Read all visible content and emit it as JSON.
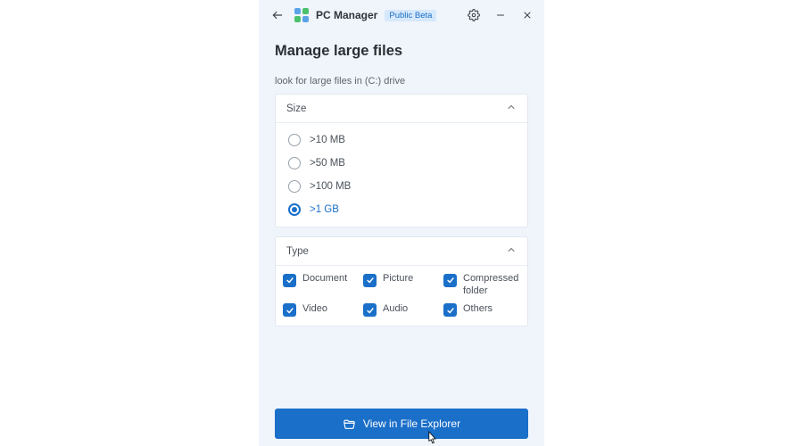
{
  "titlebar": {
    "app_name": "PC Manager",
    "badge": "Public Beta"
  },
  "header": {
    "title": "Manage large files",
    "subtitle": "look for large files in (C:) drive"
  },
  "size_panel": {
    "title": "Size",
    "options": [
      {
        "label": ">10 MB",
        "selected": false
      },
      {
        "label": ">50 MB",
        "selected": false
      },
      {
        "label": ">100 MB",
        "selected": false
      },
      {
        "label": ">1 GB",
        "selected": true
      }
    ]
  },
  "type_panel": {
    "title": "Type",
    "options": [
      {
        "label": "Document",
        "checked": true
      },
      {
        "label": "Picture",
        "checked": true
      },
      {
        "label": "Compressed folder",
        "checked": true
      },
      {
        "label": "Video",
        "checked": true
      },
      {
        "label": "Audio",
        "checked": true
      },
      {
        "label": "Others",
        "checked": true
      }
    ]
  },
  "action": {
    "label": "View in File Explorer"
  }
}
